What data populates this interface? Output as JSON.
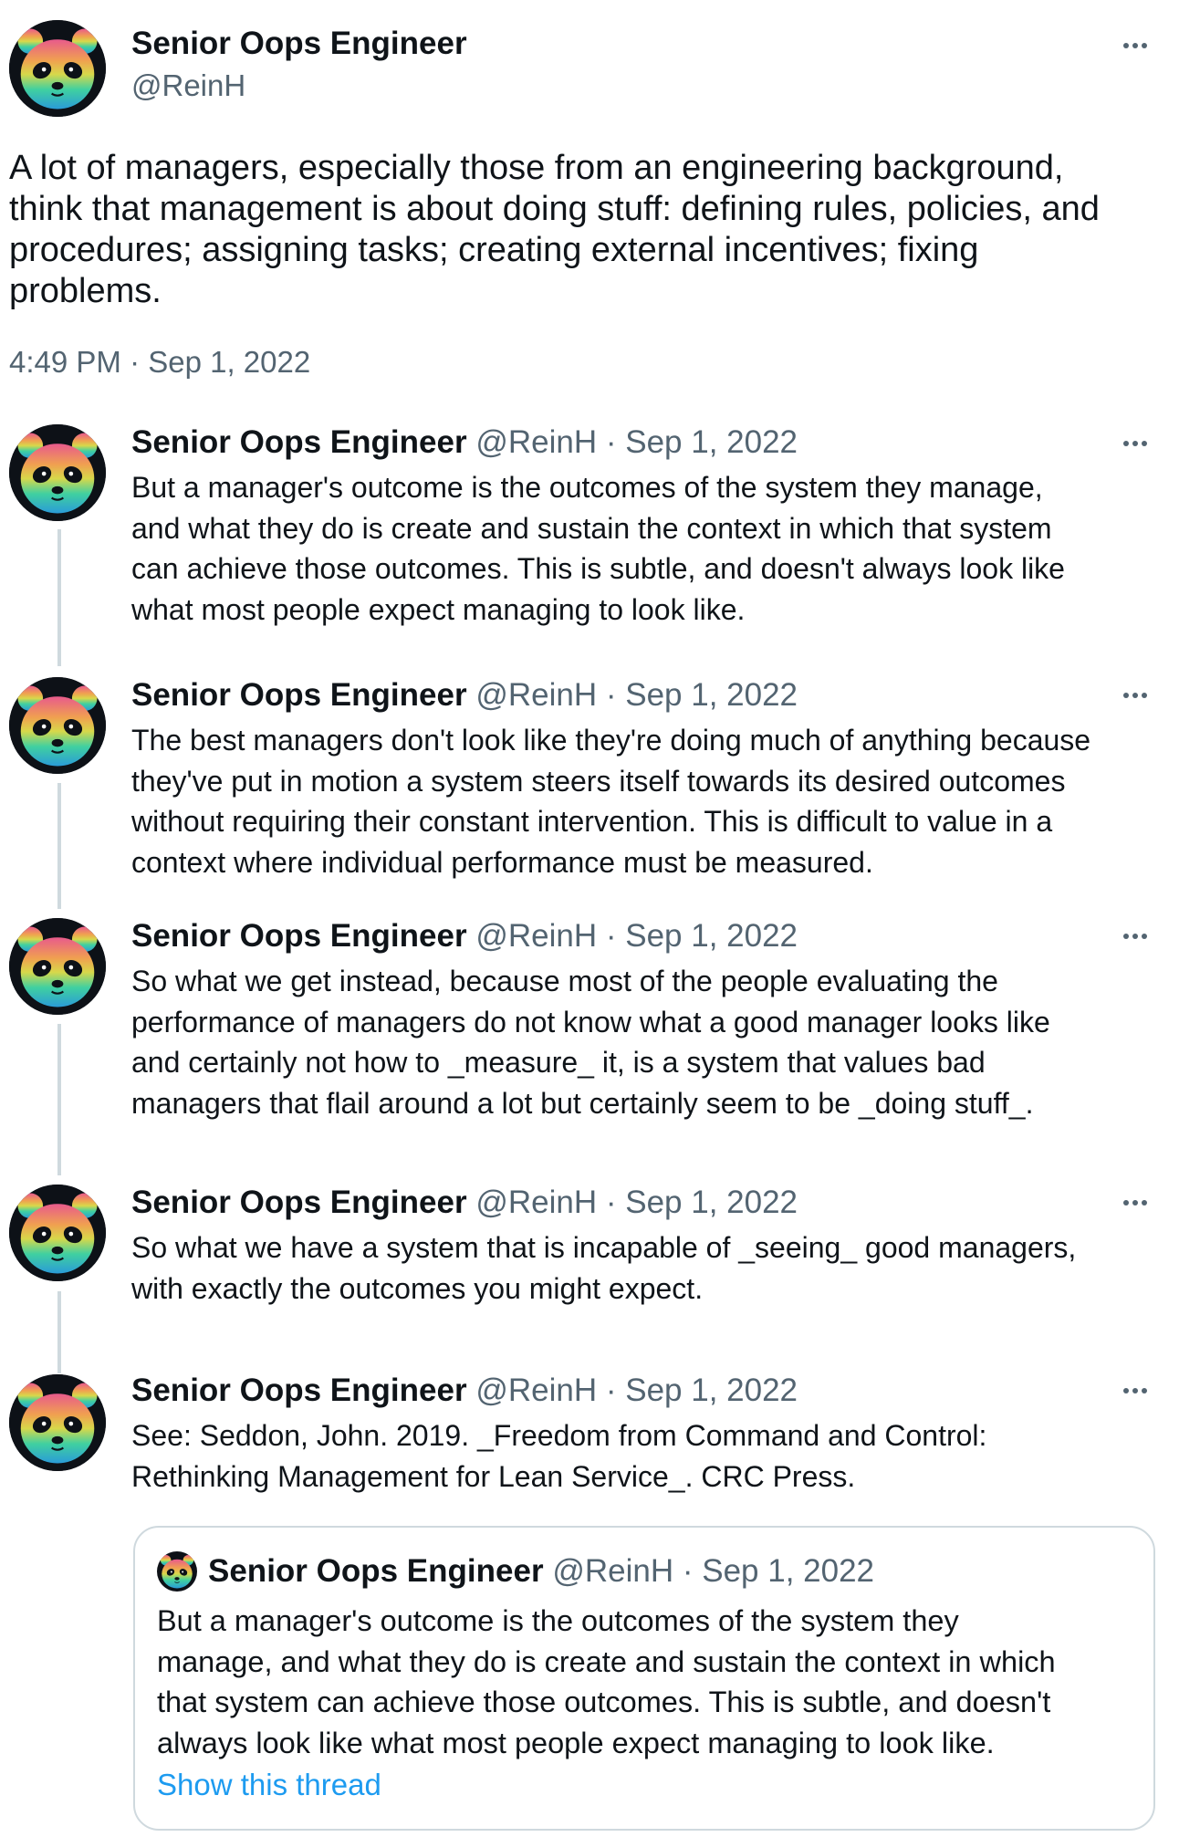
{
  "main_tweet": {
    "author_name": "Senior Oops Engineer",
    "author_handle": "@ReinH",
    "text_lines": [
      "A lot of managers, especially those from an engineering background,",
      "think that management is about doing stuff: defining rules, policies, and",
      "procedures; assigning tasks; creating external incentives; fixing",
      "problems."
    ],
    "timestamp": "4:49 PM · Sep 1, 2022",
    "more_icon": "more-horizontal-icon"
  },
  "replies": [
    {
      "author_name": "Senior Oops Engineer",
      "author_handle": "@ReinH",
      "separator": "·",
      "date": "Sep 1, 2022",
      "text_lines": [
        "But a manager's outcome is the outcomes of the system they manage,",
        "and what they do is create and sustain the context in which that system",
        "can achieve those outcomes. This is subtle, and doesn't always look like",
        "what most people expect managing to look like."
      ]
    },
    {
      "author_name": "Senior Oops Engineer",
      "author_handle": "@ReinH",
      "separator": "·",
      "date": "Sep 1, 2022",
      "text_lines": [
        "The best managers don't look like they're doing much of anything because",
        "they've put in motion a system steers itself towards its desired outcomes",
        "without requiring their constant intervention. This is difficult to value in a",
        "context where individual performance must be measured."
      ]
    },
    {
      "author_name": "Senior Oops Engineer",
      "author_handle": "@ReinH",
      "separator": "·",
      "date": "Sep 1, 2022",
      "text_lines": [
        "So what we get instead, because most of the people evaluating the",
        "performance of managers do not know what a good manager looks like",
        "and certainly not how to _measure_ it, is a system that values bad",
        "managers that flail around a lot but certainly seem to be _doing stuff_."
      ]
    },
    {
      "author_name": "Senior Oops Engineer",
      "author_handle": "@ReinH",
      "separator": "·",
      "date": "Sep 1, 2022",
      "text_lines": [
        "So what we have a system that is incapable of _seeing_ good managers,",
        "with exactly the outcomes you might expect."
      ]
    },
    {
      "author_name": "Senior Oops Engineer",
      "author_handle": "@ReinH",
      "separator": "·",
      "date": "Sep 1, 2022",
      "text_lines": [
        "See: Seddon, John. 2019. _Freedom from Command and Control:",
        "Rethinking Management for Lean Service_. CRC Press."
      ]
    }
  ],
  "quoted_tweet": {
    "author_name": "Senior Oops Engineer",
    "author_handle": "@ReinH",
    "separator": "·",
    "date": "Sep 1, 2022",
    "text_lines": [
      "But a manager's outcome is the outcomes of the system they",
      "manage, and what they do is create and sustain the context in which",
      "that system can achieve those outcomes. This is subtle, and doesn't",
      "always look like what most people expect managing to look like."
    ],
    "show_thread_label": "Show this thread"
  },
  "colors": {
    "text": "#0f1419",
    "muted": "#536471",
    "thread_line": "#cfd9de",
    "link": "#1d9bf0",
    "border": "#cfd9de"
  }
}
